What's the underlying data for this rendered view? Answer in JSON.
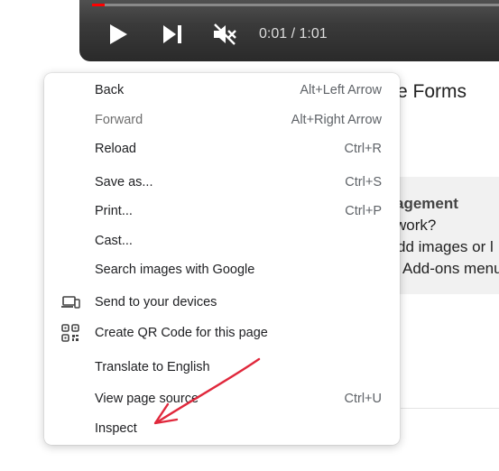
{
  "video": {
    "time": "0:01 / 1:01",
    "progress": 0.016,
    "accent": "#ff0000",
    "icons": [
      "play-icon",
      "skip-next-icon",
      "muted-volume-icon"
    ]
  },
  "page": {
    "title_fragment": "e Forms",
    "card_lines": [
      "agement",
      "work?",
      "dd images or l",
      "Add-ons menu"
    ]
  },
  "menu": {
    "items": [
      {
        "label": "Back",
        "shortcut": "Alt+Left Arrow"
      },
      {
        "label": "Forward",
        "shortcut": "Alt+Right Arrow",
        "disabled": true
      },
      {
        "label": "Reload",
        "shortcut": "Ctrl+R"
      },
      {
        "label": "Save as...",
        "shortcut": "Ctrl+S"
      },
      {
        "label": "Print...",
        "shortcut": "Ctrl+P"
      },
      {
        "label": "Cast...",
        "shortcut": ""
      },
      {
        "label": "Search images with Google",
        "shortcut": ""
      },
      {
        "label": "Send to your devices",
        "shortcut": "",
        "icon": "devices-icon"
      },
      {
        "label": "Create QR Code for this page",
        "shortcut": "",
        "icon": "qr-code-icon"
      },
      {
        "label": "Translate to English",
        "shortcut": ""
      },
      {
        "label": "View page source",
        "shortcut": "Ctrl+U"
      },
      {
        "label": "Inspect",
        "shortcut": ""
      }
    ]
  },
  "annotation": {
    "arrow_color": "#e0283c"
  }
}
